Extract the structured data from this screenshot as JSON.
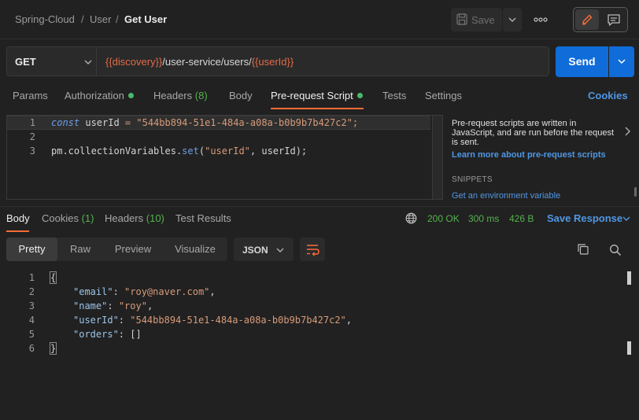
{
  "breadcrumb": {
    "items": [
      "Spring-Cloud",
      "User",
      "Get User"
    ],
    "separator": "/"
  },
  "toolbar": {
    "save_label": "Save",
    "more_label": "ooo"
  },
  "request": {
    "method": "GET",
    "url_parts": {
      "var1": "{{discovery}}",
      "path": "/user-service/users/",
      "var2": "{{userId}}"
    },
    "send_label": "Send"
  },
  "request_tabs": {
    "params": "Params",
    "authorization": "Authorization",
    "headers": "Headers",
    "headers_count": "(8)",
    "body": "Body",
    "prerequest": "Pre-request Script",
    "tests": "Tests",
    "settings": "Settings",
    "cookies": "Cookies"
  },
  "editor": {
    "line_numbers": [
      "1",
      "2",
      "3"
    ],
    "line1": {
      "kw": "const",
      "ident": " userId ",
      "op": "=",
      "str": " \"544bb894-51e1-484a-a08a-b0b9b7b427c2\";"
    },
    "line3": {
      "obj": "pm.collectionVariables.",
      "fn": "set",
      "open": "(",
      "str": "\"userId\"",
      "rest": ", userId);"
    }
  },
  "side_panel": {
    "description": "Pre-request scripts are written in JavaScript, and are run before the request is sent.",
    "learn_link": "Learn more about pre-request scripts",
    "snippets_heading": "SNIPPETS",
    "snippet_item": "Get an environment variable"
  },
  "response_tabs": {
    "body": "Body",
    "cookies": "Cookies",
    "cookies_count": "(1)",
    "headers": "Headers",
    "headers_count": "(10)",
    "test_results": "Test Results"
  },
  "response_status": {
    "code": "200 OK",
    "time": "300 ms",
    "size": "426 B",
    "save_label": "Save Response"
  },
  "format_bar": {
    "pretty": "Pretty",
    "raw": "Raw",
    "preview": "Preview",
    "visualize": "Visualize",
    "json_label": "JSON"
  },
  "response_body": {
    "line_numbers": [
      "1",
      "2",
      "3",
      "4",
      "5",
      "6"
    ],
    "open_brace": "{",
    "close_brace": "}",
    "email_key": "\"email\"",
    "email_val": "\"roy@naver.com\"",
    "name_key": "\"name\"",
    "name_val": "\"roy\"",
    "userId_key": "\"userId\"",
    "userId_val": "\"544bb894-51e1-484a-a08a-b0b9b7b427c2\"",
    "orders_key": "\"orders\"",
    "orders_val": "[]"
  },
  "colors": {
    "accent_orange": "#ff6c37",
    "send_blue": "#0f6cd8",
    "link_blue": "#4f97e5",
    "status_green": "#54b24d",
    "variable_red": "#e26b49"
  }
}
